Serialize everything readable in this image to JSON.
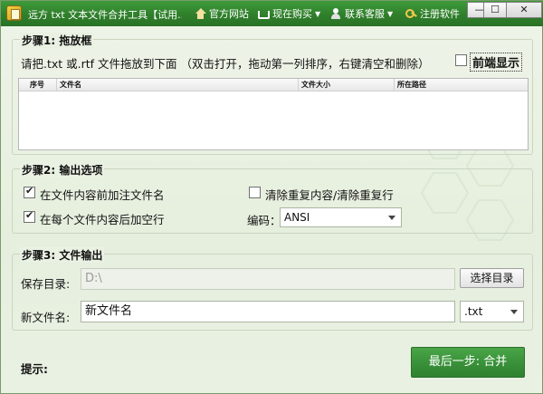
{
  "titlebar": {
    "title": "远方 txt 文本文件合并工具【试用...",
    "menu": {
      "official_site": "官方网站",
      "buy_now": "现在购买",
      "contact_support": "联系客服",
      "register": "注册软件"
    },
    "caret": "▼",
    "buttons": {
      "minimize": "—",
      "maximize": "☐",
      "close": "✕"
    }
  },
  "step1": {
    "title": "步骤1: 拖放框",
    "instruction": "请把.txt 或.rtf 文件拖放到下面 （双击打开，拖动第一列排序，右键清空和删除）",
    "front_display_label": "前端显示",
    "columns": [
      "序号",
      "文件名",
      "文件大小",
      "所在路径"
    ],
    "rows": []
  },
  "step2": {
    "title": "步骤2: 输出选项",
    "opt_prepend_filename": {
      "label": "在文件内容前加注文件名",
      "checked": true
    },
    "opt_append_blankline": {
      "label": "在每个文件内容后加空行",
      "checked": true
    },
    "opt_dedupe": {
      "label": "清除重复内容/清除重复行",
      "checked": false
    },
    "encoding_label": "编码：",
    "encoding_value": "ANSI"
  },
  "step3": {
    "title": "步骤3: 文件输出",
    "save_dir_label": "保存目录:",
    "save_dir_value": "D:\\",
    "choose_dir_button": "选择目录",
    "new_filename_label": "新文件名:",
    "new_filename_value": "新文件名",
    "extension_value": ".txt"
  },
  "footer": {
    "tip_label": "提示:",
    "merge_button": "最后一步: 合并"
  },
  "colors": {
    "titlebar": "#2f7f2b",
    "merge_button": "#3a923a",
    "background": "#e9f1e3"
  }
}
